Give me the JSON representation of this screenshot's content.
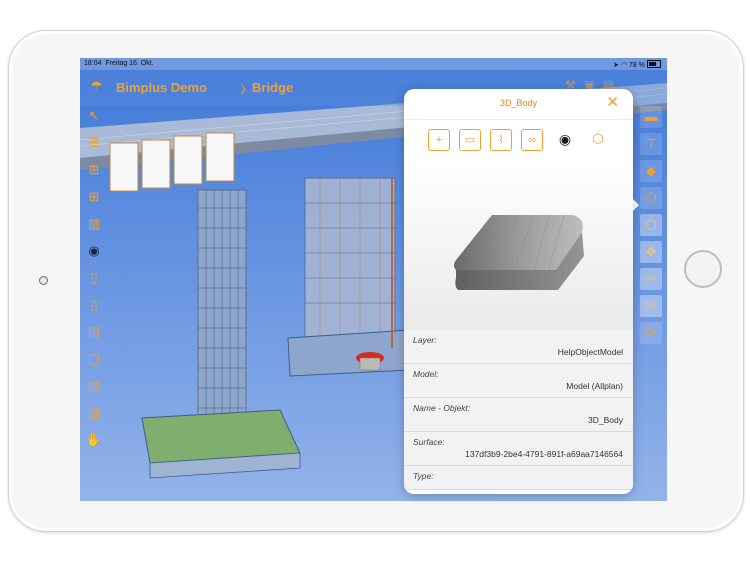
{
  "status_bar": {
    "time": "18:04",
    "date": "Freitag 16. Okt.",
    "battery": "78 %"
  },
  "nav": {
    "app_title": "Bimplus Demo",
    "breadcrumb_sep": "〉",
    "breadcrumb": "Bridge"
  },
  "panel": {
    "title": "3D_Body",
    "properties": [
      {
        "label": "Layer:",
        "value": "HelpObjectModel"
      },
      {
        "label": "Model:",
        "value": "Model (Allplan)"
      },
      {
        "label": "Name - Objekt:",
        "value": "3D_Body"
      },
      {
        "label": "Surface:",
        "value": "137df3b9-2be4-4791-891f-a69aa7146564"
      },
      {
        "label": "Type:",
        "value": ""
      }
    ]
  },
  "colors": {
    "accent": "#f0a030",
    "sky": "#5b8de0",
    "panel_bg": "#ffffff"
  },
  "icons": {
    "left_toolbar": [
      "back-icon",
      "layers-icon",
      "add-document-icon",
      "add-document-icon",
      "book-icon",
      "eye-icon",
      "clipboard-icon",
      "clipboard-icon",
      "document-icon",
      "document-icon",
      "document-icon",
      "book-icon",
      "hand-icon"
    ],
    "right_toolbar": [
      "box-icon",
      "hierarchy-icon",
      "layer-icon",
      "cube-icon",
      "cube-outline-icon",
      "move-icon",
      "cut-icon",
      "fit-icon",
      "refresh-icon"
    ],
    "panel_toolbar": [
      "add-document-icon",
      "comment-icon",
      "attachment-icon",
      "link-icon",
      "eye-icon",
      "cube-small-icon"
    ]
  }
}
